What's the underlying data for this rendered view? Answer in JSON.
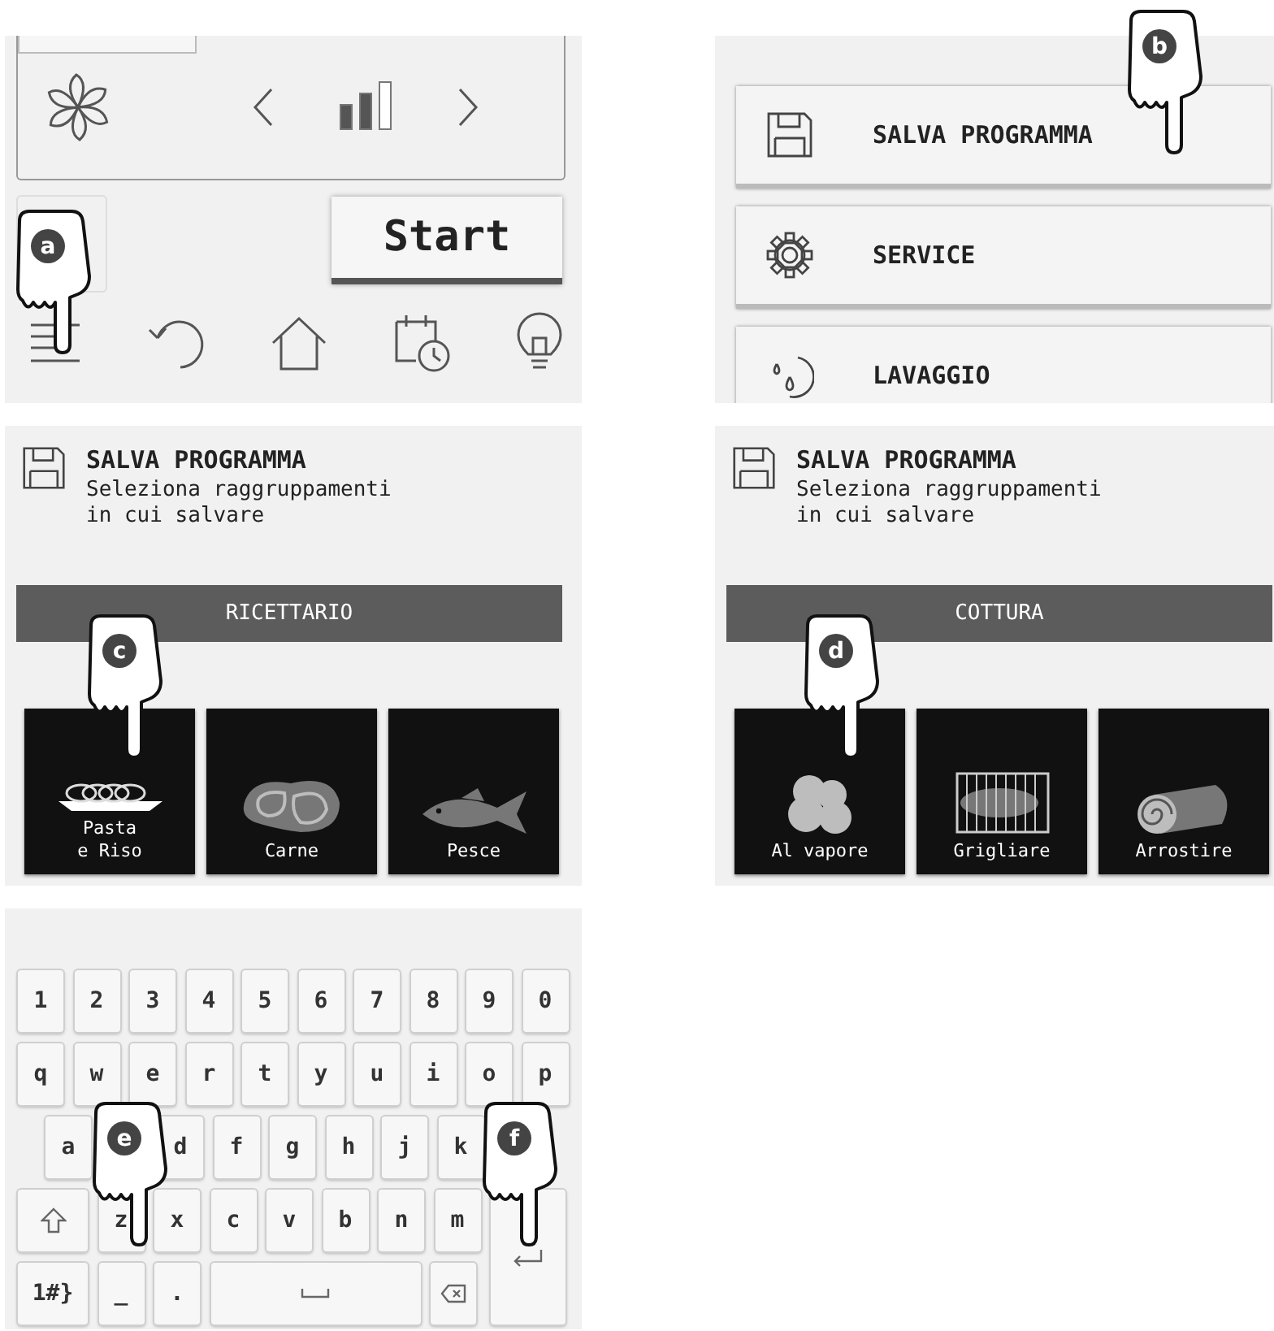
{
  "control_panel": {
    "fan_speed": {
      "level": 0.67
    },
    "start_button": "Start",
    "callout": "a"
  },
  "menu": {
    "items": [
      {
        "label": "SALVA PROGRAMMA",
        "kind": "save"
      },
      {
        "label": "SERVICE",
        "kind": "service"
      },
      {
        "label": "LAVAGGIO",
        "kind": "wash"
      }
    ],
    "callout": "b"
  },
  "save_screens": [
    {
      "title": "SALVA PROGRAMMA",
      "subtitle": "Seleziona raggruppamenti in cui salvare",
      "category": "RICETTARIO",
      "callout": "c",
      "tiles": [
        {
          "label": "Pasta\ne Riso",
          "kind": "pasta"
        },
        {
          "label": "Carne",
          "kind": "meat"
        },
        {
          "label": "Pesce",
          "kind": "fish"
        }
      ]
    },
    {
      "title": "SALVA PROGRAMMA",
      "subtitle": "Seleziona raggruppamenti in cui salvare",
      "category": "COTTURA",
      "callout": "d",
      "tiles": [
        {
          "label": "Al vapore",
          "kind": "steam"
        },
        {
          "label": "Grigliare",
          "kind": "grill"
        },
        {
          "label": "Arrostire",
          "kind": "roast"
        }
      ]
    }
  ],
  "keyboard": {
    "callouts": [
      "e",
      "f"
    ],
    "rows": [
      [
        {
          "kind": "char",
          "label": "1"
        },
        {
          "kind": "char",
          "label": "2"
        },
        {
          "kind": "char",
          "label": "3"
        },
        {
          "kind": "char",
          "label": "4"
        },
        {
          "kind": "char",
          "label": "5"
        },
        {
          "kind": "char",
          "label": "6"
        },
        {
          "kind": "char",
          "label": "7"
        },
        {
          "kind": "char",
          "label": "8"
        },
        {
          "kind": "char",
          "label": "9"
        },
        {
          "kind": "char",
          "label": "0"
        }
      ],
      [
        {
          "kind": "char",
          "label": "q"
        },
        {
          "kind": "char",
          "label": "w"
        },
        {
          "kind": "char",
          "label": "e"
        },
        {
          "kind": "char",
          "label": "r"
        },
        {
          "kind": "char",
          "label": "t"
        },
        {
          "kind": "char",
          "label": "y"
        },
        {
          "kind": "char",
          "label": "u"
        },
        {
          "kind": "char",
          "label": "i"
        },
        {
          "kind": "char",
          "label": "o"
        },
        {
          "kind": "char",
          "label": "p"
        }
      ],
      [
        {
          "kind": "char",
          "label": "a"
        },
        {
          "kind": "covered"
        },
        {
          "kind": "char",
          "label": "d"
        },
        {
          "kind": "char",
          "label": "f"
        },
        {
          "kind": "char",
          "label": "g"
        },
        {
          "kind": "char",
          "label": "h"
        },
        {
          "kind": "char",
          "label": "j"
        },
        {
          "kind": "char",
          "label": "k"
        },
        {
          "kind": "covered"
        }
      ],
      [
        {
          "kind": "shift"
        },
        {
          "kind": "char",
          "label": "z"
        },
        {
          "kind": "char",
          "label": "x"
        },
        {
          "kind": "char",
          "label": "c"
        },
        {
          "kind": "char",
          "label": "v"
        },
        {
          "kind": "char",
          "label": "b"
        },
        {
          "kind": "char",
          "label": "n"
        },
        {
          "kind": "char",
          "label": "m"
        },
        {
          "kind": "enter"
        }
      ],
      [
        {
          "kind": "wide",
          "label": "1#}"
        },
        {
          "kind": "char",
          "label": "_"
        },
        {
          "kind": "char",
          "label": "."
        },
        {
          "kind": "space"
        },
        {
          "kind": "backspace"
        }
      ]
    ]
  }
}
